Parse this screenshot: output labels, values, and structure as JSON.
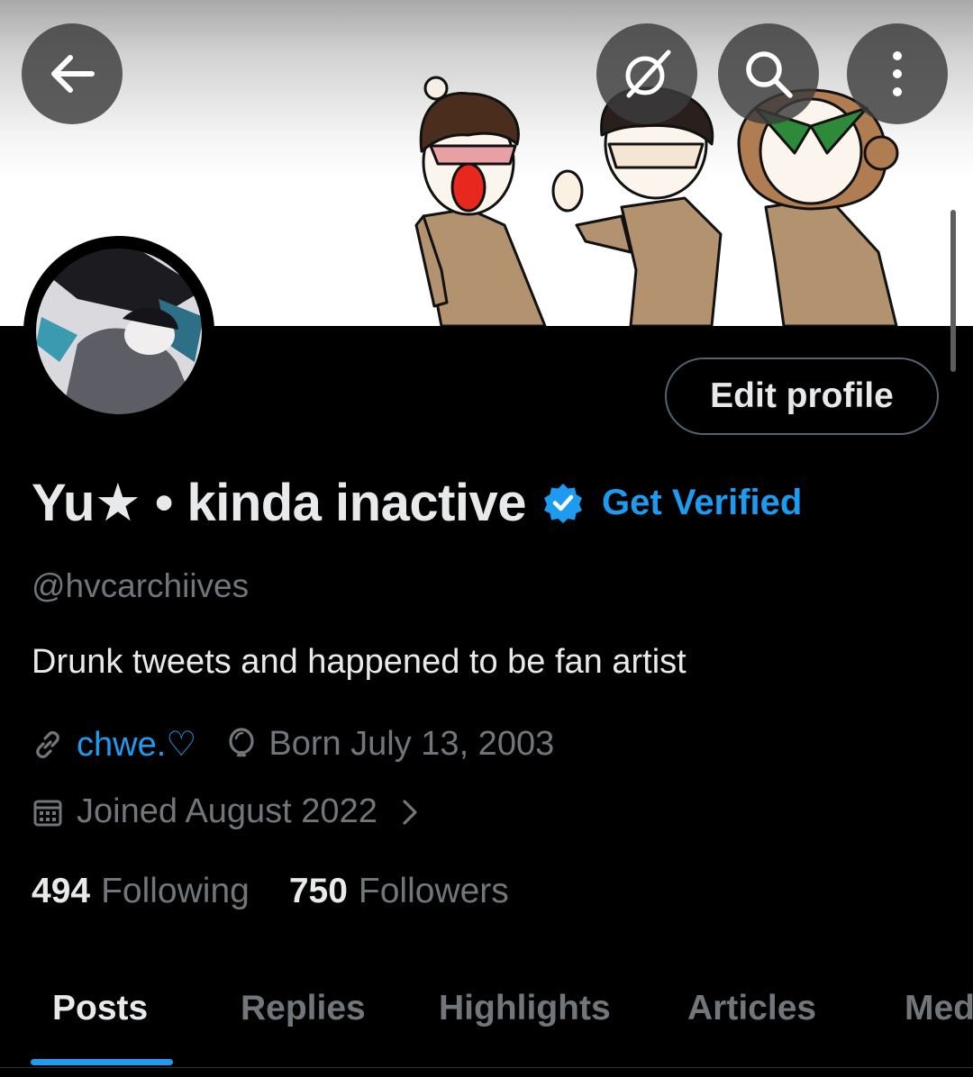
{
  "header": {
    "back_icon": "arrow-left-icon",
    "grok_icon": "grok-icon",
    "search_icon": "search-icon",
    "more_icon": "more-vertical-icon"
  },
  "profile": {
    "display_name": "Yu★ • kinda inactive",
    "verified_icon": "verified-badge-icon",
    "get_verified_label": "Get Verified",
    "handle": "@hvcarchiives",
    "bio": "Drunk tweets and happened to be fan artist",
    "website": "chwe.♡",
    "birthday": "Born July 13, 2003",
    "joined": "Joined August 2022",
    "edit_profile_label": "Edit profile"
  },
  "stats": {
    "following_count": "494",
    "following_label": "Following",
    "followers_count": "750",
    "followers_label": "Followers"
  },
  "tabs": [
    {
      "label": "Posts",
      "active": true
    },
    {
      "label": "Replies",
      "active": false
    },
    {
      "label": "Highlights",
      "active": false
    },
    {
      "label": "Articles",
      "active": false
    },
    {
      "label": "Media",
      "active": false
    }
  ],
  "colors": {
    "accent": "#1d9bf0",
    "background": "#000000",
    "primary_text": "#e7e9ea",
    "secondary_text": "#71767b"
  }
}
